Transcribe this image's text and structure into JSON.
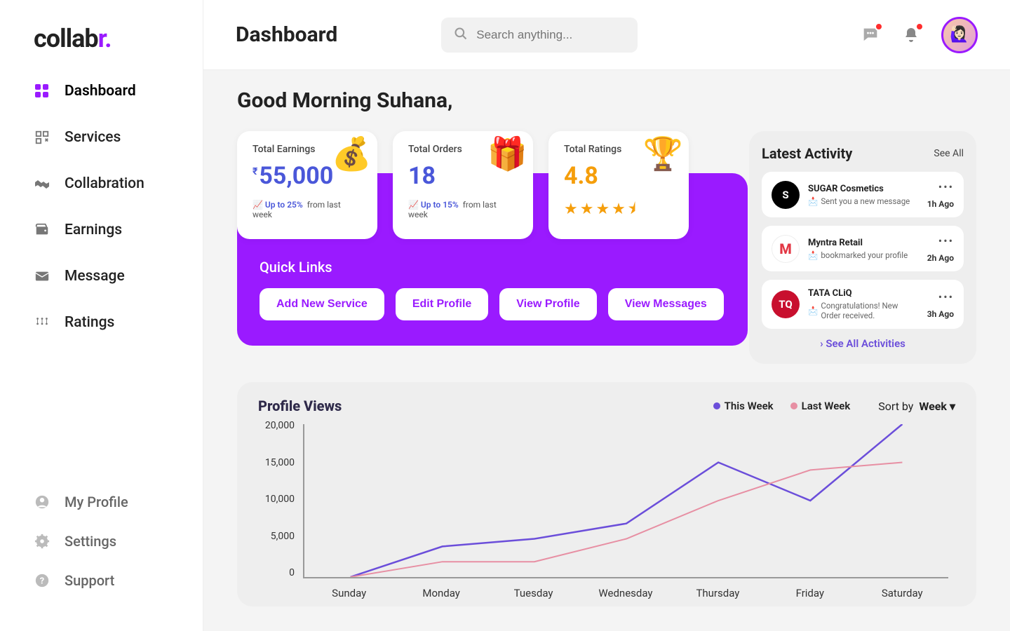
{
  "brand": {
    "name_part1": "collab",
    "name_part2": "r",
    "dot": "."
  },
  "sidebar": {
    "items": [
      {
        "label": "Dashboard",
        "active": true
      },
      {
        "label": "Services"
      },
      {
        "label": "Collabration"
      },
      {
        "label": "Earnings"
      },
      {
        "label": "Message"
      },
      {
        "label": "Ratings"
      }
    ],
    "bottom": [
      {
        "label": "My Profile"
      },
      {
        "label": "Settings"
      },
      {
        "label": "Support"
      }
    ]
  },
  "topbar": {
    "title": "Dashboard",
    "search_placeholder": "Search anything..."
  },
  "greeting": "Good Morning Suhana,",
  "stats": {
    "earnings": {
      "label": "Total Earnings",
      "currency": "₹",
      "value": "55,000",
      "trend_pct": "Up to 25%",
      "trend_text": "from last week"
    },
    "orders": {
      "label": "Total Orders",
      "value": "18",
      "trend_pct": "Up to 15%",
      "trend_text": "from last week"
    },
    "ratings": {
      "label": "Total Ratings",
      "value": "4.8",
      "stars": "★★★★⯨"
    }
  },
  "quick_links": {
    "title": "Quick Links",
    "buttons": [
      "Add New Service",
      "Edit Profile",
      "View Profile",
      "View Messages"
    ]
  },
  "activity": {
    "title": "Latest Activity",
    "see_all": "See All",
    "see_all_link": "› See All Activities",
    "items": [
      {
        "name": "SUGAR Cosmetics",
        "sub": "Sent you a new message",
        "time": "1h Ago",
        "avatar_bg": "#000",
        "avatar_txt": "S"
      },
      {
        "name": "Myntra Retail",
        "sub": "bookmarked your profile",
        "time": "2h Ago",
        "avatar_bg": "#fff",
        "avatar_txt": "M",
        "avatar_style": "myntra"
      },
      {
        "name": "TATA CLiQ",
        "sub": "Congratulations! New Order received.",
        "time": "3h Ago",
        "avatar_bg": "#c80f2e",
        "avatar_txt": "TQ"
      }
    ]
  },
  "chart": {
    "title": "Profile Views",
    "legend": {
      "this_week": "This Week",
      "last_week": "Last Week"
    },
    "sort_label": "Sort by",
    "sort_value": "Week",
    "colors": {
      "this_week": "#6b4eda",
      "last_week": "#e78fa3"
    }
  },
  "chart_data": {
    "type": "line",
    "categories": [
      "Sunday",
      "Monday",
      "Tuesday",
      "Wednesday",
      "Thursday",
      "Friday",
      "Saturday"
    ],
    "series": [
      {
        "name": "This Week",
        "values": [
          0,
          4000,
          5000,
          7000,
          15000,
          10000,
          20000
        ]
      },
      {
        "name": "Last Week",
        "values": [
          0,
          2000,
          2000,
          5000,
          10000,
          14000,
          15000
        ]
      }
    ],
    "ylabels": [
      "20,000",
      "15,000",
      "10,000",
      "5,000",
      "0"
    ],
    "ylim": [
      0,
      20000
    ],
    "xlabel": "",
    "ylabel": ""
  }
}
